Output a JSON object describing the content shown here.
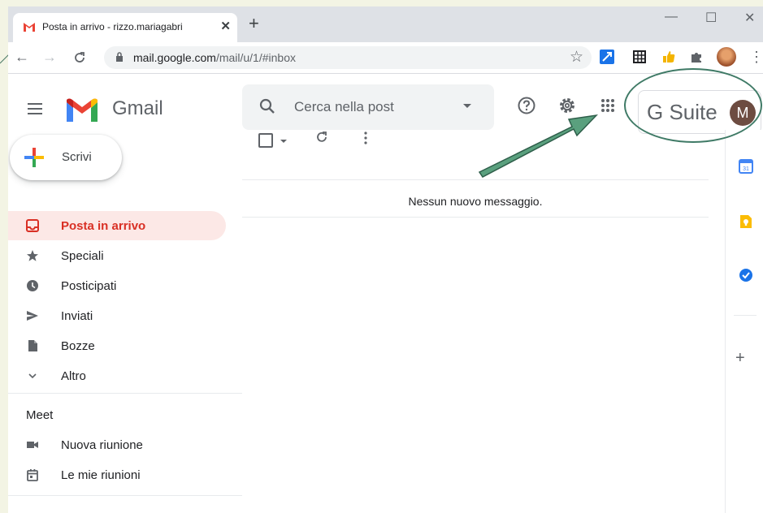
{
  "browser": {
    "tab_title": "Posta in arrivo - rizzo.mariagabri",
    "tab_close": "✕",
    "new_tab": "+",
    "window_controls": {
      "minimize": "—",
      "maximize": "☐",
      "close": "✕"
    },
    "url_host": "mail.google.com",
    "url_path": "/mail/u/1/#inbox",
    "bookmark_icon": "star-icon",
    "extensions": [
      "link-extension-icon",
      "grid-extension-icon",
      "thumbs-up-extension-icon",
      "puzzle-extension-icon"
    ]
  },
  "header": {
    "brand": "Gmail",
    "search_placeholder": "Cerca nella post",
    "help_icon": "help-icon",
    "settings_icon": "gear-icon",
    "apps_icon": "apps-grid-icon",
    "gsuite_label": "G Suite",
    "avatar_initial": "M",
    "avatar_color": "#6d4c41"
  },
  "compose": {
    "label": "Scrivi"
  },
  "sidebar": {
    "items": [
      {
        "label": "Posta in arrivo",
        "icon": "inbox-icon",
        "active": true
      },
      {
        "label": "Speciali",
        "icon": "star-icon"
      },
      {
        "label": "Posticipati",
        "icon": "clock-icon"
      },
      {
        "label": "Inviati",
        "icon": "send-icon"
      },
      {
        "label": "Bozze",
        "icon": "draft-icon"
      },
      {
        "label": "Altro",
        "icon": "chevron-down-icon"
      }
    ],
    "meet": {
      "title": "Meet",
      "items": [
        {
          "label": "Nuova riunione",
          "icon": "video-icon"
        },
        {
          "label": "Le mie riunioni",
          "icon": "calendar-icon"
        }
      ]
    }
  },
  "main": {
    "empty_message": "Nessun nuovo messaggio."
  },
  "side_panel": {
    "apps": [
      "calendar-app-icon",
      "keep-app-icon",
      "tasks-app-icon"
    ],
    "add_label": "+"
  },
  "colors": {
    "accent_red": "#d93025",
    "active_bg": "#fce8e6",
    "highlight_green": "#3f7a66"
  }
}
